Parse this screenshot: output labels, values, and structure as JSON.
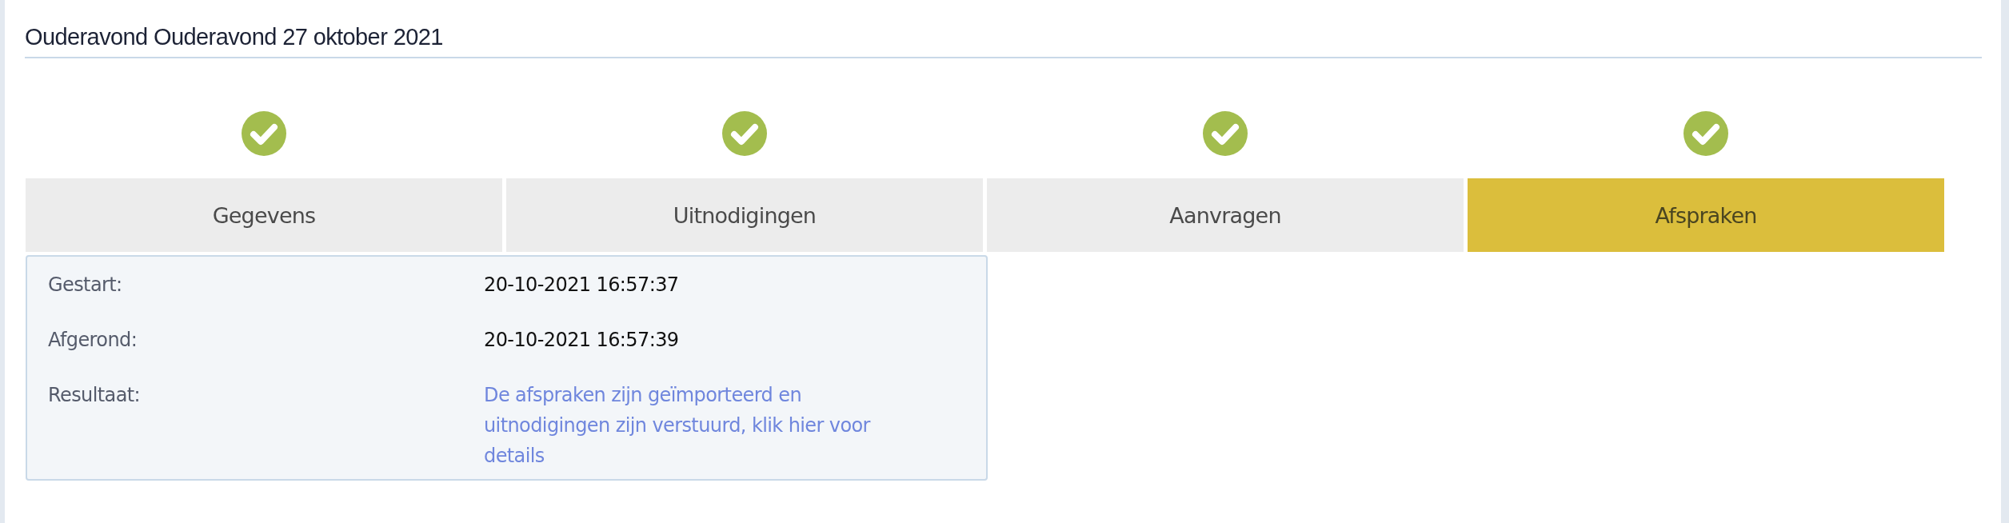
{
  "title": "Ouderavond Ouderavond 27 oktober 2021",
  "steps": [
    {
      "label": "Gegevens",
      "done": true,
      "selected": false
    },
    {
      "label": "Uitnodigingen",
      "done": true,
      "selected": false
    },
    {
      "label": "Aanvragen",
      "done": true,
      "selected": false
    },
    {
      "label": "Afspraken",
      "done": true,
      "selected": true
    }
  ],
  "details": [
    {
      "label": "Gestart:",
      "value": "20-10-2021 16:57:37",
      "kind": "text"
    },
    {
      "label": "Afgerond:",
      "value": "20-10-2021 16:57:39",
      "kind": "text"
    },
    {
      "label": "Resultaat:",
      "value": "De afspraken zijn geïmporteerd en uitnodigingen zijn verstuurd, klik hier voor details",
      "kind": "link"
    }
  ]
}
